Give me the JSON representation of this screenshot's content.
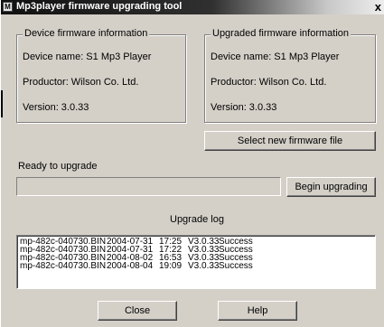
{
  "window": {
    "title": "Mp3player firmware upgrading tool",
    "title_icon": "app-icon",
    "close_glyph": "x"
  },
  "device": {
    "legend": "Device firmware information",
    "name_line": "Device name: S1 Mp3 Player",
    "productor_line": "Productor: Wilson Co. Ltd.",
    "version_line": "Version: 3.0.33"
  },
  "upgraded": {
    "legend": "Upgraded firmware information",
    "name_line": "Device name: S1 Mp3 Player",
    "productor_line": "Productor: Wilson Co. Ltd.",
    "version_line": "Version: 3.0.33"
  },
  "actions": {
    "select_file_label": "Select new firmware file",
    "begin_label": "Begin upgrading",
    "close_label": "Close",
    "help_label": "Help"
  },
  "status": {
    "text": "Ready to upgrade",
    "progress_fraction": 0
  },
  "log": {
    "title": "Upgrade log",
    "rows": [
      {
        "file": "mp-482c-040730.BIN",
        "date": "2004-07-31",
        "time": "17:25",
        "version": "V3.0.33",
        "result": "Success"
      },
      {
        "file": "mp-482c-040730.BIN",
        "date": "2004-07-31",
        "time": "17:22",
        "version": "V3.0.33",
        "result": "Success"
      },
      {
        "file": "mp-482c-040730.BIN",
        "date": "2004-08-02",
        "time": "16:53",
        "version": "V3.0.33",
        "result": "Success"
      },
      {
        "file": "mp-482c-040730.BIN",
        "date": "2004-08-04",
        "time": "19:09",
        "version": "V3.0.33",
        "result": "Success"
      }
    ]
  },
  "colors": {
    "face": "#d4d0c8",
    "title_dark": "#101010",
    "progress_fill": "#0a246a"
  }
}
